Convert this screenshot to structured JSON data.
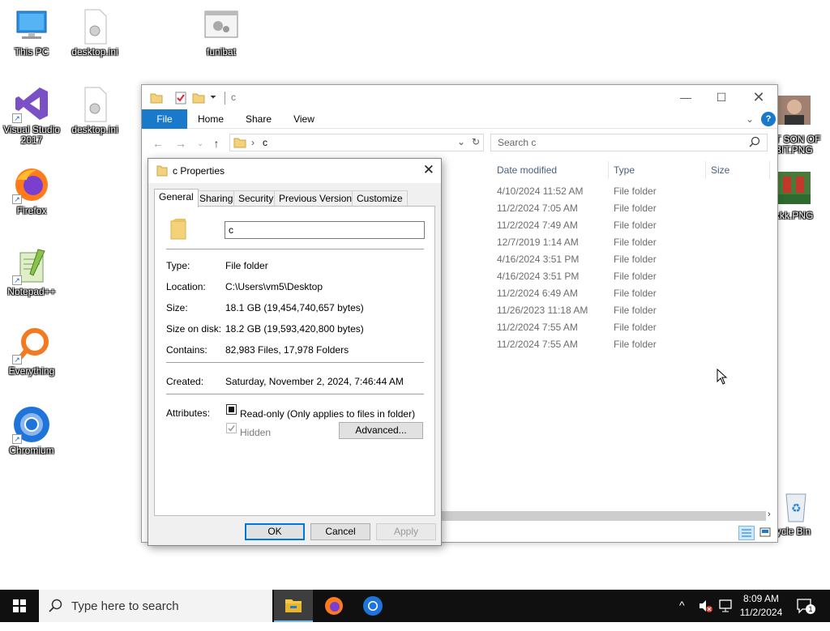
{
  "desktop": {
    "icons": [
      {
        "label": "This PC"
      },
      {
        "label": "desktop.ini"
      },
      {
        "label": "funibat"
      },
      {
        "label": "Visual Studio 2017"
      },
      {
        "label": "desktop.ini"
      },
      {
        "label": "Firefox"
      },
      {
        "label": "Notepad++"
      },
      {
        "label": "Everything"
      },
      {
        "label": "Chromium"
      },
      {
        "label": "T SON OF BIT.PNG"
      },
      {
        "label": "kkk.PNG"
      },
      {
        "label": "ycle Bin"
      }
    ]
  },
  "explorer": {
    "title": "c",
    "ribbon_tabs": [
      "File",
      "Home",
      "Share",
      "View"
    ],
    "address": {
      "breadcrumb_sep": "›",
      "path": "c"
    },
    "search_placeholder": "Search c",
    "columns": [
      "Date modified",
      "Type",
      "Size"
    ],
    "rows": [
      {
        "date": "4/10/2024 11:52 AM",
        "type": "File folder"
      },
      {
        "date": "11/2/2024 7:05 AM",
        "type": "File folder"
      },
      {
        "date": "11/2/2024 7:49 AM",
        "type": "File folder"
      },
      {
        "date": "12/7/2019 1:14 AM",
        "type": "File folder"
      },
      {
        "date": "4/16/2024 3:51 PM",
        "type": "File folder"
      },
      {
        "date": "4/16/2024 3:51 PM",
        "type": "File folder"
      },
      {
        "date": "11/2/2024 6:49 AM",
        "type": "File folder"
      },
      {
        "date": "11/26/2023 11:18 AM",
        "type": "File folder"
      },
      {
        "date": "11/2/2024 7:55 AM",
        "type": "File folder"
      },
      {
        "date": "11/2/2024 7:55 AM",
        "type": "File folder"
      }
    ],
    "help_label": "?"
  },
  "properties": {
    "title": "c Properties",
    "tabs": [
      "General",
      "Sharing",
      "Security",
      "Previous Versions",
      "Customize"
    ],
    "name_value": "c",
    "fields": {
      "type_label": "Type:",
      "type_value": "File folder",
      "location_label": "Location:",
      "location_value": "C:\\Users\\vm5\\Desktop",
      "size_label": "Size:",
      "size_value": "18.1 GB (19,454,740,657 bytes)",
      "size_on_disk_label": "Size on disk:",
      "size_on_disk_value": "18.2 GB (19,593,420,800 bytes)",
      "contains_label": "Contains:",
      "contains_value": "82,983 Files, 17,978 Folders",
      "created_label": "Created:",
      "created_value": "Saturday, November 2, 2024, 7:46:44 AM",
      "attributes_label": "Attributes:"
    },
    "readonly_label": "Read-only (Only applies to files in folder)",
    "hidden_label": "Hidden",
    "advanced_label": "Advanced...",
    "ok_label": "OK",
    "cancel_label": "Cancel",
    "apply_label": "Apply"
  },
  "taskbar": {
    "search_placeholder": "Type here to search",
    "time": "8:09 AM",
    "date": "11/2/2024",
    "notification_count": "1"
  },
  "colors": {
    "accent": "#0078d7",
    "file_tab": "#1979ca",
    "taskbar": "#101010"
  }
}
